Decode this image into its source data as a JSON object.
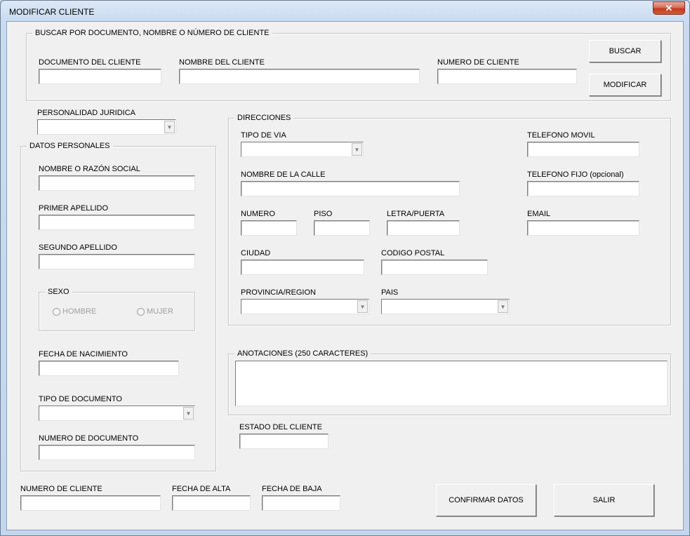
{
  "window": {
    "title": "MODIFICAR CLIENTE",
    "close_label": "✕"
  },
  "search": {
    "frame_title": "BUSCAR POR DOCUMENTO, NOMBRE O NÚMERO DE CLIENTE",
    "documento_label": "DOCUMENTO DEL CLIENTE",
    "nombre_label": "NOMBRE DEL CLIENTE",
    "numero_label": "NUMERO DE CLIENTE",
    "buscar_button": "BUSCAR",
    "modificar_button": "MODIFICAR"
  },
  "personalidad": {
    "label": "PERSONALIDAD JURIDICA"
  },
  "personal": {
    "frame_title": "DATOS PERSONALES",
    "nombre_label": "NOMBRE O RAZÓN SOCIAL",
    "apellido1_label": "PRIMER APELLIDO",
    "apellido2_label": "SEGUNDO APELLIDO",
    "sexo_title": "SEXO",
    "hombre_label": "HOMBRE",
    "mujer_label": "MUJER",
    "nacimiento_label": "FECHA DE NACIMIENTO",
    "tipo_doc_label": "TIPO DE DOCUMENTO",
    "num_doc_label": "NUMERO DE DOCUMENTO"
  },
  "direcciones": {
    "frame_title": "DIRECCIONES",
    "tipo_via_label": "TIPO DE VIA",
    "calle_label": "NOMBRE DE LA CALLE",
    "numero_label": "NUMERO",
    "piso_label": "PISO",
    "letra_label": "LETRA/PUERTA",
    "ciudad_label": "CIUDAD",
    "cp_label": "CODIGO POSTAL",
    "provincia_label": "PROVINCIA/REGION",
    "pais_label": "PAIS",
    "movil_label": "TELEFONO MOVIL",
    "fijo_label": "TELEFONO FIJO (opcional)",
    "email_label": "EMAIL"
  },
  "anotaciones": {
    "frame_title": "ANOTACIONES (250 CARACTERES)"
  },
  "estado": {
    "label": "ESTADO DEL CLIENTE"
  },
  "footer": {
    "numero_label": "NUMERO DE CLIENTE",
    "alta_label": "FECHA DE ALTA",
    "baja_label": "FECHA DE BAJA",
    "confirmar_button": "CONFIRMAR DATOS",
    "salir_button": "SALIR"
  }
}
